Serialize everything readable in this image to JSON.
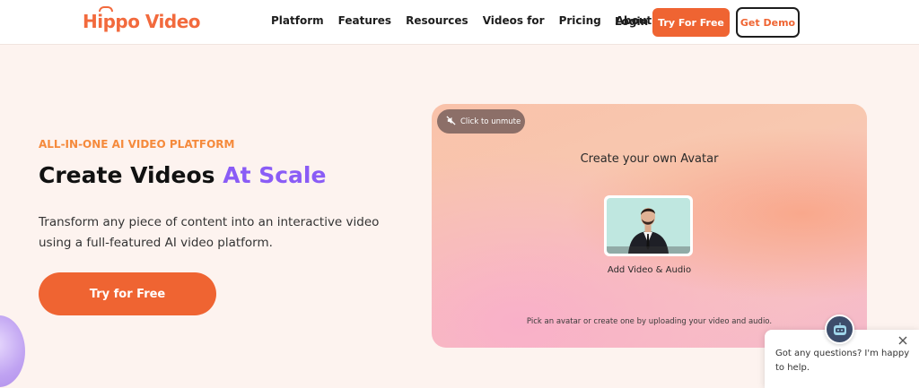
{
  "header": {
    "logo": "Hippo Video",
    "nav": [
      "Platform",
      "Features",
      "Resources",
      "Videos for",
      "Pricing",
      "About us"
    ],
    "login": "Login",
    "try_label": "Try For Free",
    "demo_label": "Get Demo"
  },
  "hero": {
    "eyebrow": "ALL-IN-ONE AI VIDEO PLATFORM",
    "headline_main": "Create Videos",
    "headline_accent": "At Scale",
    "subtext": "Transform any piece of content into an interactive video using a full-featured AI video platform.",
    "cta": "Try for Free"
  },
  "video": {
    "unmute_label": "Click to unmute",
    "title": "Create your own Avatar",
    "caption": "Add Video & Audio",
    "footer": "Pick an avatar or create one by uploading your video and audio."
  },
  "chat": {
    "message": "Got any questions? I'm happy to help."
  },
  "colors": {
    "accent": "#ef6432",
    "headline_accent": "#8a5cf6",
    "eyebrow": "#f58a3c"
  },
  "icons": {
    "unmute": "muted-speaker-icon",
    "close": "close-icon",
    "chat": "chat-bot-icon"
  }
}
